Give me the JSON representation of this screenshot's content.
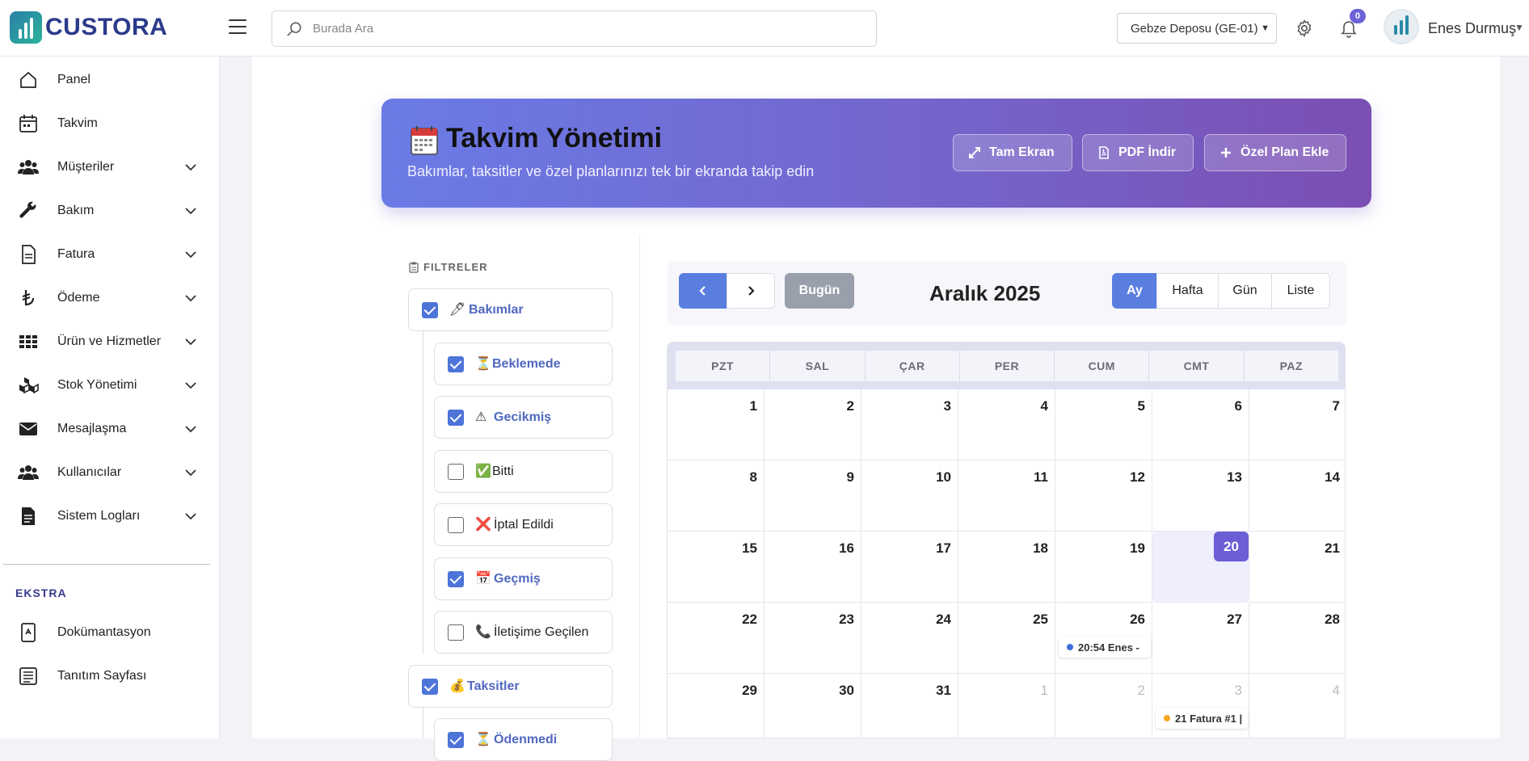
{
  "brand": {
    "name": "CUSTORA"
  },
  "search": {
    "placeholder": "Burada Ara"
  },
  "header": {
    "depot": "Gebze Deposu (GE-01)",
    "notifications": "0",
    "user": "Enes Durmuş"
  },
  "sidebar": {
    "items": [
      {
        "label": "Panel",
        "icon": "home-icon"
      },
      {
        "label": "Takvim",
        "icon": "calendar-icon"
      },
      {
        "label": "Müşteriler",
        "icon": "users-icon"
      },
      {
        "label": "Bakım",
        "icon": "wrench-icon"
      },
      {
        "label": "Fatura",
        "icon": "document-icon"
      },
      {
        "label": "Ödeme",
        "icon": "lira-icon"
      },
      {
        "label": "Ürün ve Hizmetler",
        "icon": "grid-icon"
      },
      {
        "label": "Stok Yönetimi",
        "icon": "boxes-icon"
      },
      {
        "label": "Mesajlaşma",
        "icon": "envelope-icon"
      },
      {
        "label": "Kullanıcılar",
        "icon": "users-icon"
      },
      {
        "label": "Sistem Logları",
        "icon": "file-icon"
      }
    ],
    "extra_title": "EKSTRA",
    "extra": [
      {
        "label": "Dokümantasyon",
        "icon": "book-icon"
      },
      {
        "label": "Tanıtım Sayfası",
        "icon": "newspaper-icon"
      }
    ]
  },
  "hero": {
    "title": "Takvim Yönetimi",
    "subtitle": "Bakımlar, taksitler ve özel planlarınızı tek bir ekranda takip edin",
    "buttons": {
      "fullscreen": "Tam Ekran",
      "pdf": "PDF İndir",
      "add": "Özel Plan Ekle"
    }
  },
  "filters": {
    "title": "FILTRELER",
    "items": [
      {
        "label": "Bakımlar",
        "emoji": "🖊",
        "checked": true
      },
      {
        "label": "Beklemede",
        "emoji": "⏳",
        "checked": true
      },
      {
        "label": "Gecikmiş",
        "emoji": "⚠",
        "checked": true
      },
      {
        "label": "Bitti",
        "emoji": "✅",
        "checked": false
      },
      {
        "label": "İptal Edildi",
        "emoji": "❌",
        "checked": false
      },
      {
        "label": "Geçmiş",
        "emoji": "📅",
        "checked": true
      },
      {
        "label": "İletişime Geçilen",
        "emoji": "📞",
        "checked": false
      },
      {
        "label": "Taksitler",
        "emoji": "💰",
        "checked": true
      },
      {
        "label": "Ödenmedi",
        "emoji": "⏳",
        "checked": true
      }
    ]
  },
  "calendar": {
    "today_label": "Bugün",
    "month_title": "Aralık 2025",
    "views": [
      "Ay",
      "Hafta",
      "Gün",
      "Liste"
    ],
    "active_view": "Ay",
    "weekdays": [
      "PZT",
      "SAL",
      "ÇAR",
      "PER",
      "CUM",
      "CMT",
      "PAZ"
    ],
    "weeks": [
      [
        "1",
        "2",
        "3",
        "4",
        "5",
        "6",
        "7"
      ],
      [
        "8",
        "9",
        "10",
        "11",
        "12",
        "13",
        "14"
      ],
      [
        "15",
        "16",
        "17",
        "18",
        "19",
        "20",
        "21"
      ],
      [
        "22",
        "23",
        "24",
        "25",
        "26",
        "27",
        "28"
      ],
      [
        "29",
        "30",
        "31",
        "1",
        "2",
        "3",
        "4"
      ]
    ],
    "today": "20",
    "events": [
      {
        "week": 3,
        "day": 4,
        "text": "20:54 Enes -",
        "color": "#3b6fd9"
      },
      {
        "week": 4,
        "day": 5,
        "text": "21 Fatura #1 |",
        "color": "#f5a623"
      }
    ]
  }
}
